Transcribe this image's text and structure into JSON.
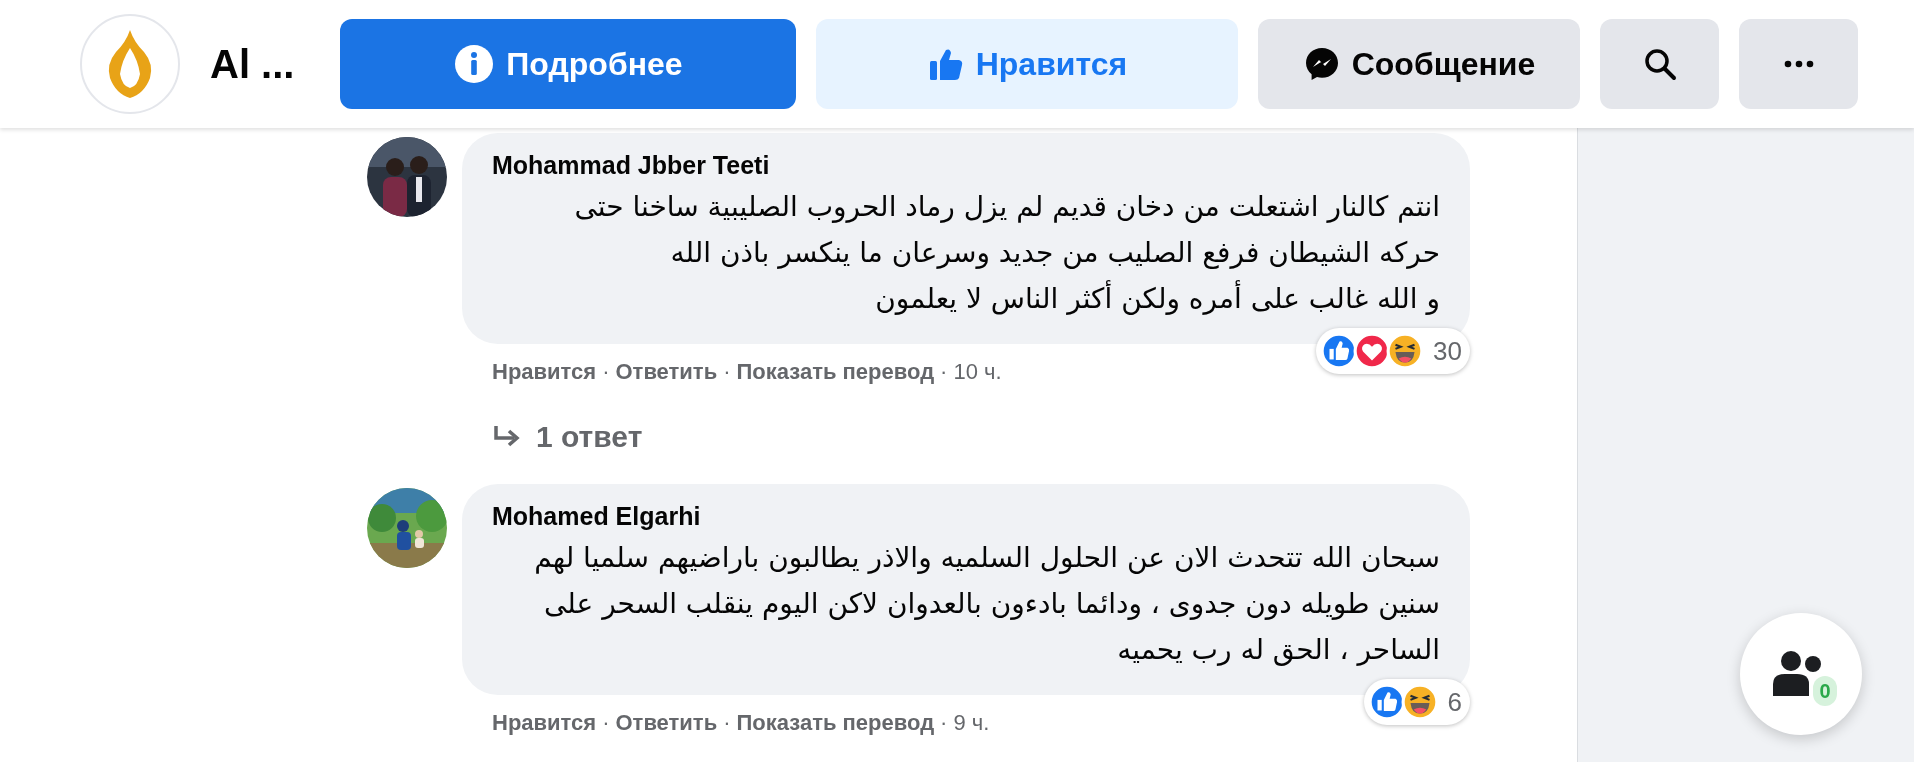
{
  "page": {
    "name": "Al ...",
    "buttons": [
      {
        "kind": "info",
        "label": "Подробнее"
      },
      {
        "kind": "like",
        "label": "Нравится"
      },
      {
        "kind": "message",
        "label": "Сообщение"
      },
      {
        "kind": "search"
      },
      {
        "kind": "more"
      }
    ]
  },
  "comments": [
    {
      "author": "Mohammad Jbber Teeti",
      "lines": [
        "انتم كالنار  اشتعلت من دخان قديم لم يزل رماد الحروب الصليبية ساخنا حتى",
        "حركه الشيطان فرفع الصليب من جديد وسرعان ما ينكسر باذن الله",
        "و الله غالب على أمره ولكن أكثر الناس لا يعلمون"
      ],
      "reactions": [
        {
          "kind": "like"
        },
        {
          "kind": "love"
        },
        {
          "kind": "haha"
        }
      ],
      "reaction_count": "30",
      "actions": [
        "Нравится",
        "Ответить",
        "Показать перевод"
      ],
      "separator": "·",
      "time": "10 ч.",
      "replies": "1 ответ"
    },
    {
      "author": "Mohamed Elgarhi",
      "lines": [
        "سبحان الله تتحدث الان عن الحلول السلميه والاذر يطالبون باراضيهم سلميا لهم",
        "سنين طويله دون جدوى ، ودائما بادءون بالعدوان لاكن اليوم ينقلب السحر على",
        "الساحر ، الحق له رب يحميه"
      ],
      "reactions": [
        {
          "kind": "like"
        },
        {
          "kind": "haha"
        }
      ],
      "reaction_count": "6",
      "actions": [
        "Нравится",
        "Ответить",
        "Показать перевод"
      ],
      "separator": "·",
      "time": "9 ч."
    }
  ],
  "chat_button": {
    "badge": "0"
  }
}
